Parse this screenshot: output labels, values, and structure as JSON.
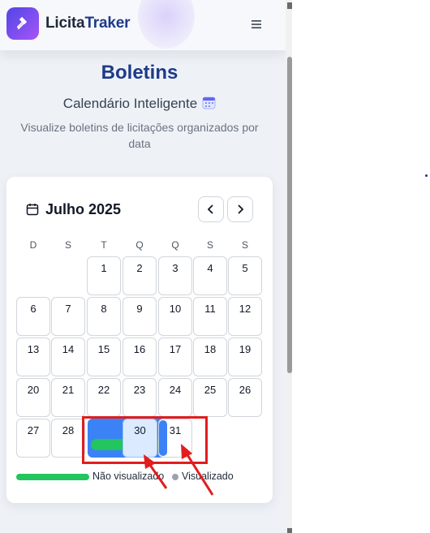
{
  "header": {
    "brand_part1": "Licita",
    "brand_part2": "Traker",
    "logo_icon": "gavel-icon",
    "menu_icon": "hamburger-icon"
  },
  "page": {
    "title": "Boletins",
    "subtitle": "Calendário Inteligente",
    "subtitle_icon": "calendar-emoji-icon",
    "description": "Visualize boletins de licitações organizados por data"
  },
  "calendar": {
    "month_label": "Julho 2025",
    "weekdays": [
      "D",
      "S",
      "T",
      "Q",
      "Q",
      "S",
      "S"
    ],
    "weeks": [
      [
        "",
        "",
        "1",
        "2",
        "3",
        "4",
        "5"
      ],
      [
        "6",
        "7",
        "8",
        "9",
        "10",
        "11",
        "12"
      ],
      [
        "13",
        "14",
        "15",
        "16",
        "17",
        "18",
        "19"
      ],
      [
        "20",
        "21",
        "22",
        "23",
        "24",
        "25",
        "26"
      ],
      [
        "27",
        "28",
        "",
        "30",
        "31",
        "",
        ""
      ]
    ],
    "selected_day": "30",
    "day_31": "31"
  },
  "legend": {
    "not_viewed": "Não visualizado",
    "viewed": "Visualizado"
  },
  "colors": {
    "accent": "#1e3a8a",
    "selection": "#3b82f6",
    "not_viewed": "#22c55e",
    "viewed": "#9ca3af",
    "annotation": "#e11d1d"
  }
}
